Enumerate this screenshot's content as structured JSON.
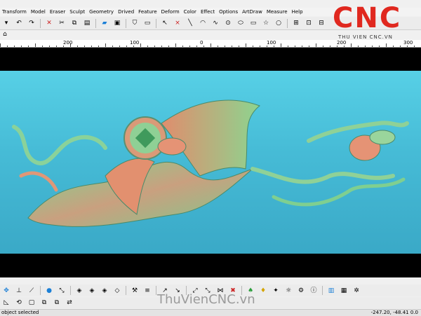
{
  "menu": [
    "Transform",
    "Model",
    "Eraser",
    "Sculpt",
    "Geometry",
    "Drived",
    "Feature",
    "Deform",
    "Color",
    "Effect",
    "Options",
    "ArtDraw",
    "Measure",
    "Help"
  ],
  "toolbar1_icons": [
    "dropdown-icon",
    "undo-icon",
    "redo-icon",
    "delete-icon",
    "cut-icon",
    "copy-icon",
    "paste-icon",
    "color-icon",
    "view-icon",
    "shield-icon",
    "monitor-icon",
    "select-icon",
    "line-icon",
    "arc-icon",
    "curve-icon",
    "circle-icon",
    "ellipse-icon",
    "rectangle-icon",
    "star-icon",
    "circle-outline-icon",
    "grid-icon",
    "snap-icon",
    "align-icon"
  ],
  "toolbar2_icons": [
    "origin-icon",
    "base-icon",
    "slope-icon",
    "point-icon",
    "fit-icon",
    "mesh1-icon",
    "mesh2-icon",
    "mesh3-icon",
    "tool-icon",
    "arrow1-icon",
    "arrow2-icon",
    "move-icon",
    "scale-icon",
    "delete-x-icon",
    "bulb1-icon",
    "bulb2-icon",
    "light-icon",
    "sun-icon",
    "gear-icon",
    "info-icon",
    "layer-icon",
    "table-icon",
    "settings-icon"
  ],
  "toolbar3_icons": [
    "mirror-icon",
    "rotate-icon",
    "frame-icon",
    "copy2-icon",
    "copy3-icon",
    "flip-icon"
  ],
  "ruler": {
    "labels": [
      "200",
      "100",
      "0",
      "100",
      "200",
      "300"
    ]
  },
  "logo": {
    "text": "CNC",
    "subtitle": "THU VIEN CNC.VN"
  },
  "watermark": "ThuVienCNC.vn",
  "status": {
    "left": "object selected",
    "coords": "-247.20, -48.41 0.0"
  }
}
